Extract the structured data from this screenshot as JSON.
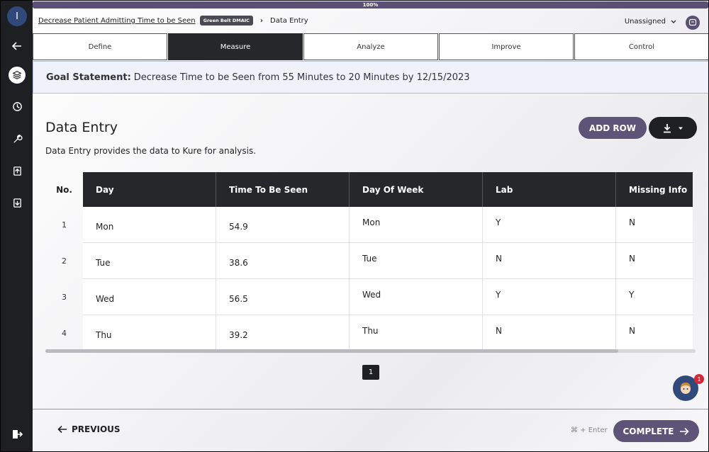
{
  "progress": {
    "label": "100%",
    "value": 1.0
  },
  "breadcrumb": {
    "project_link": "Decrease Patient Admitting Time to be Seen",
    "project_tag": "Green Belt DMAIC",
    "current": "Data Entry"
  },
  "assignee": {
    "label": "Unassigned"
  },
  "sidebar": {
    "avatar_initial": "I",
    "items": [
      {
        "name": "back-arrow-icon"
      },
      {
        "name": "layers-icon",
        "active": true
      },
      {
        "name": "clock-icon"
      },
      {
        "name": "wrench-icon"
      },
      {
        "name": "upload-icon"
      },
      {
        "name": "download-icon"
      },
      {
        "name": "logout-icon"
      }
    ]
  },
  "tabs": [
    {
      "label": "Define",
      "active": false
    },
    {
      "label": "Measure",
      "active": true
    },
    {
      "label": "Analyze",
      "active": false
    },
    {
      "label": "Improve",
      "active": false
    },
    {
      "label": "Control",
      "active": false
    }
  ],
  "goal": {
    "label": "Goal Statement:",
    "text": "Decrease Time to be Seen from 55 Minutes to 20 Minutes by 12/15/2023"
  },
  "section": {
    "title": "Data Entry",
    "description": "Data Entry provides the data to Kure for analysis.",
    "add_row_label": "ADD ROW"
  },
  "table": {
    "no_header": "No.",
    "headers": [
      "Day",
      "Time To Be Seen",
      "Day Of Week",
      "Lab",
      "Missing Info"
    ],
    "rows": [
      {
        "no": "1",
        "day": "Mon",
        "time": "54.9",
        "dow": "Mon",
        "lab": "Y",
        "missing": "N"
      },
      {
        "no": "2",
        "day": "Tue",
        "time": "38.6",
        "dow": "Tue",
        "lab": "N",
        "missing": "N"
      },
      {
        "no": "3",
        "day": "Wed",
        "time": "56.5",
        "dow": "Wed",
        "lab": "Y",
        "missing": "Y"
      },
      {
        "no": "4",
        "day": "Thu",
        "time": "39.2",
        "dow": "Thu",
        "lab": "N",
        "missing": "N"
      }
    ]
  },
  "pagination": {
    "current_page": "1"
  },
  "help": {
    "badge_count": "1"
  },
  "footer": {
    "previous_label": "PREVIOUS",
    "shortcut": "⌘ + Enter",
    "complete_label": "COMPLETE"
  },
  "colors": {
    "accent": "#5e5478",
    "dark": "#26272b",
    "sidebar": "#1e1f23",
    "goal_bg": "#f0f2fb"
  }
}
